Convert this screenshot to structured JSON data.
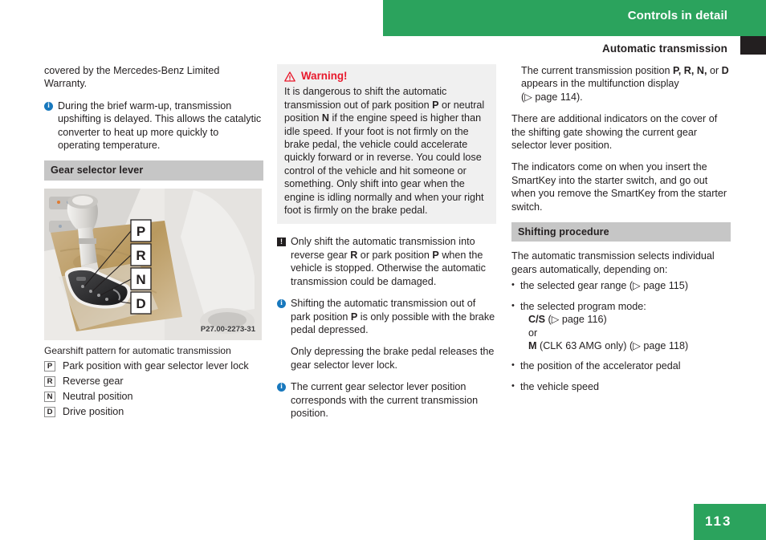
{
  "header": {
    "chapter": "Controls in detail",
    "section": "Automatic transmission"
  },
  "footer": {
    "page_number": "113"
  },
  "left_column": {
    "continuation_paragraph": "covered by the Mercedes-Benz Limited Warranty.",
    "info_note": "During the brief warm-up, transmission upshifting is delayed. This allows the catalytic converter to heat up more quickly to operating temperature.",
    "section_heading": "Gear selector lever",
    "figure_id": "P27.00-2273-31",
    "figure_caption": "Gearshift pattern for automatic transmission",
    "legend": [
      {
        "key": "P",
        "text": "Park position with gear selector lever lock"
      },
      {
        "key": "R",
        "text": "Reverse gear"
      },
      {
        "key": "N",
        "text": "Neutral position"
      },
      {
        "key": "D",
        "text": "Drive position"
      }
    ],
    "figure_callouts": [
      "P",
      "R",
      "N",
      "D"
    ]
  },
  "middle_column": {
    "warning": {
      "title": "Warning!",
      "line1": "It is dangerous to shift the automatic transmission out of park position ",
      "key1": "P",
      "line2": " or neutral position ",
      "key2": "N",
      "line3": " if the engine speed is higher than idle speed. If your foot is not firmly on the brake pedal, the vehicle could accelerate quickly forward or in reverse. You could lose control of the vehicle and hit someone or something. Only shift into gear when the engine is idling normally and when your right foot is firmly on the brake pedal."
    },
    "caution_note": {
      "line1": "Only shift the automatic transmission into reverse gear ",
      "key1": "R",
      "line2": " or park position ",
      "key2": "P",
      "line3": " when the vehicle is stopped. Otherwise the automatic transmission could be damaged."
    },
    "info_note_1": {
      "line1": "Shifting the automatic transmission out of park position ",
      "key1": "P",
      "line2": " is only possible with the brake pedal depressed.",
      "continuation": "Only depressing the brake pedal releases the gear selector lever lock."
    },
    "info_note_2": "The current gear selector lever position corresponds with the current transmission position."
  },
  "right_column": {
    "continuation": {
      "part1": "The current transmission position ",
      "keys": "P, R, N,",
      "part2": " or ",
      "key3": "D",
      "part3": " appears in the multifunction display (",
      "page_ref": "▷ page 114",
      "part4": ")."
    },
    "paragraph_1": "There are additional indicators on the cover of the shifting gate showing the current gear selector lever position.",
    "paragraph_2": "The indicators come on when you insert the SmartKey into the starter switch, and go out when you remove the SmartKey from the starter switch.",
    "section_heading": "Shifting procedure",
    "intro": "The automatic transmission selects individual gears automatically, depending on:",
    "bullets": [
      {
        "text": "the selected gear range (",
        "page_ref": "▷ page 115",
        "tail": ")"
      },
      {
        "text": "the selected program mode:"
      },
      {
        "text": "the position of the accelerator pedal"
      },
      {
        "text": "the vehicle speed"
      }
    ],
    "program_modes": {
      "mode_1": "C/S",
      "mode_1_ref": "▷ page 116",
      "or": "or",
      "mode_2": "M",
      "mode_2_note": "(CLK 63 AMG only)",
      "mode_2_ref": "▷ page 118"
    }
  },
  "colors": {
    "brand_green": "#2ba35d",
    "warning_red": "#e8192c",
    "info_blue": "#1878bd",
    "heading_gray": "#c6c6c6",
    "warn_box_gray": "#f0f0f0",
    "text_black": "#231f20"
  }
}
